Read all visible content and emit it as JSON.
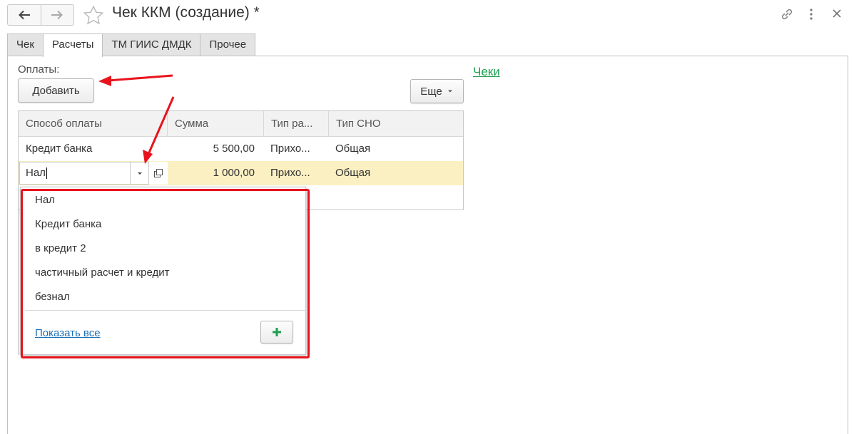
{
  "window": {
    "title": "Чек ККМ (создание) *"
  },
  "tabs": [
    {
      "label": "Чек",
      "active": false
    },
    {
      "label": "Расчеты",
      "active": true
    },
    {
      "label": "ТМ ГИИС ДМДК",
      "active": false
    },
    {
      "label": "Прочее",
      "active": false
    }
  ],
  "payments": {
    "label": "Оплаты:",
    "add_label": "Добавить",
    "more_label": "Еще",
    "columns": [
      "Способ оплаты",
      "Сумма",
      "Тип ра...",
      "Тип СНО"
    ],
    "rows": [
      {
        "method": "Кредит банка",
        "sum": "5 500,00",
        "type": "Прихо...",
        "sno": "Общая"
      },
      {
        "method": "Нал",
        "sum": "1 000,00",
        "type": "Прихо...",
        "sno": "Общая"
      }
    ]
  },
  "checks_link": "Чеки",
  "dropdown": {
    "items": [
      "Нал",
      "Кредит банка",
      "в кредит 2",
      "частичный расчет и кредит",
      "безнал"
    ],
    "show_all": "Показать все"
  },
  "colors": {
    "accent_green": "#1e9e50",
    "highlight_row": "#fbf0c2",
    "annotation_red": "#e8131d",
    "link_blue": "#1a6fb5"
  },
  "icons": [
    "back-arrow-icon",
    "forward-arrow-icon",
    "favorite-star-icon",
    "link-icon",
    "more-vertical-icon",
    "close-icon",
    "dropdown-arrow-icon",
    "open-form-icon",
    "plus-icon"
  ]
}
